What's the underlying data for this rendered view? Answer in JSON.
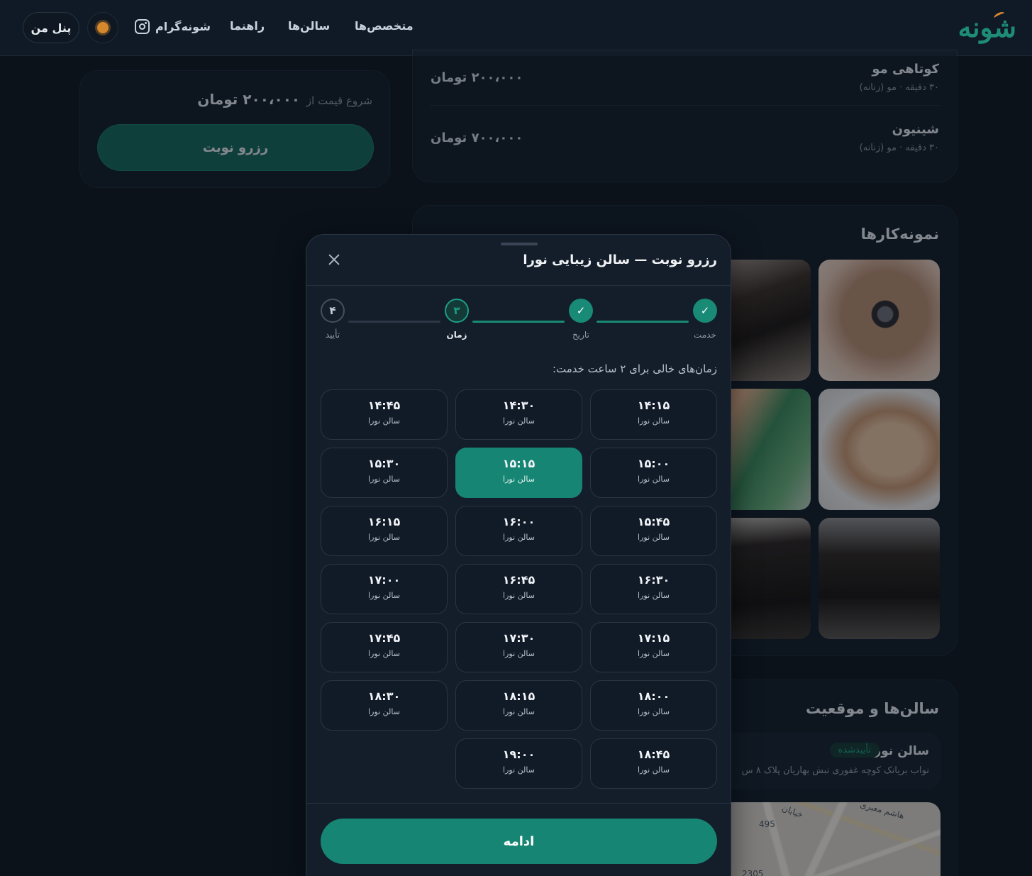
{
  "header": {
    "logo_text": "شونه",
    "nav": {
      "experts": "متخصص‌ها",
      "salons": "سالن‌ها",
      "guide": "راهنما",
      "instagram": "شونه‌گرام"
    },
    "theme_icon": "sun-icon",
    "panel_label": "پنل من"
  },
  "price_card": {
    "prefix": "شروع قیمت از",
    "price": "۲۰۰،۰۰۰ تومان",
    "reserve_label": "رزرو نوبت"
  },
  "services": [
    {
      "name": "کوتاهی مو",
      "meta": "۳۰ دقیقه · مو (زنانه)",
      "price": "۲۰۰،۰۰۰ تومان"
    },
    {
      "name": "شینیون",
      "meta": "۳۰ دقیقه · مو (زنانه)",
      "price": "۷۰۰،۰۰۰ تومان"
    }
  ],
  "portfolio": {
    "title": "نمونه‌کارها"
  },
  "locations": {
    "title": "سالن‌ها و موقعیت",
    "salon_name": "سالن نورا",
    "badge": "تأییدشده",
    "address": "نواب بریانک کوچه غفوری نبش بهاریان پلاک ۸ س",
    "map_labels": {
      "num1": "495",
      "num2": "2305",
      "street1": "هاشم معبری",
      "street2": "خیابان"
    }
  },
  "modal": {
    "title": "رزرو نوبت — سالن زیبایی نورا",
    "close_icon": "close-icon",
    "steps": [
      {
        "label": "خدمت",
        "mark": "✓",
        "state": "done"
      },
      {
        "label": "تاریخ",
        "mark": "✓",
        "state": "done"
      },
      {
        "label": "زمان",
        "mark": "۳",
        "state": "current"
      },
      {
        "label": "تأیید",
        "mark": "۴",
        "state": "pending"
      }
    ],
    "slots_heading": "زمان‌های خالی برای ۲ ساعت خدمت:",
    "slot_place": "سالن نورا",
    "slots": [
      "۱۴:۱۵",
      "۱۴:۳۰",
      "۱۴:۴۵",
      "۱۵:۰۰",
      "۱۵:۱۵",
      "۱۵:۳۰",
      "۱۵:۴۵",
      "۱۶:۰۰",
      "۱۶:۱۵",
      "۱۶:۳۰",
      "۱۶:۴۵",
      "۱۷:۰۰",
      "۱۷:۱۵",
      "۱۷:۳۰",
      "۱۷:۴۵",
      "۱۸:۰۰",
      "۱۸:۱۵",
      "۱۸:۳۰",
      "۱۸:۴۵",
      "۱۹:۰۰"
    ],
    "selected_slot": "۱۵:۱۵",
    "continue_label": "ادامه"
  },
  "colors": {
    "accent": "#178573",
    "background": "#0d1620",
    "logo_accent": "#d98a2b"
  }
}
